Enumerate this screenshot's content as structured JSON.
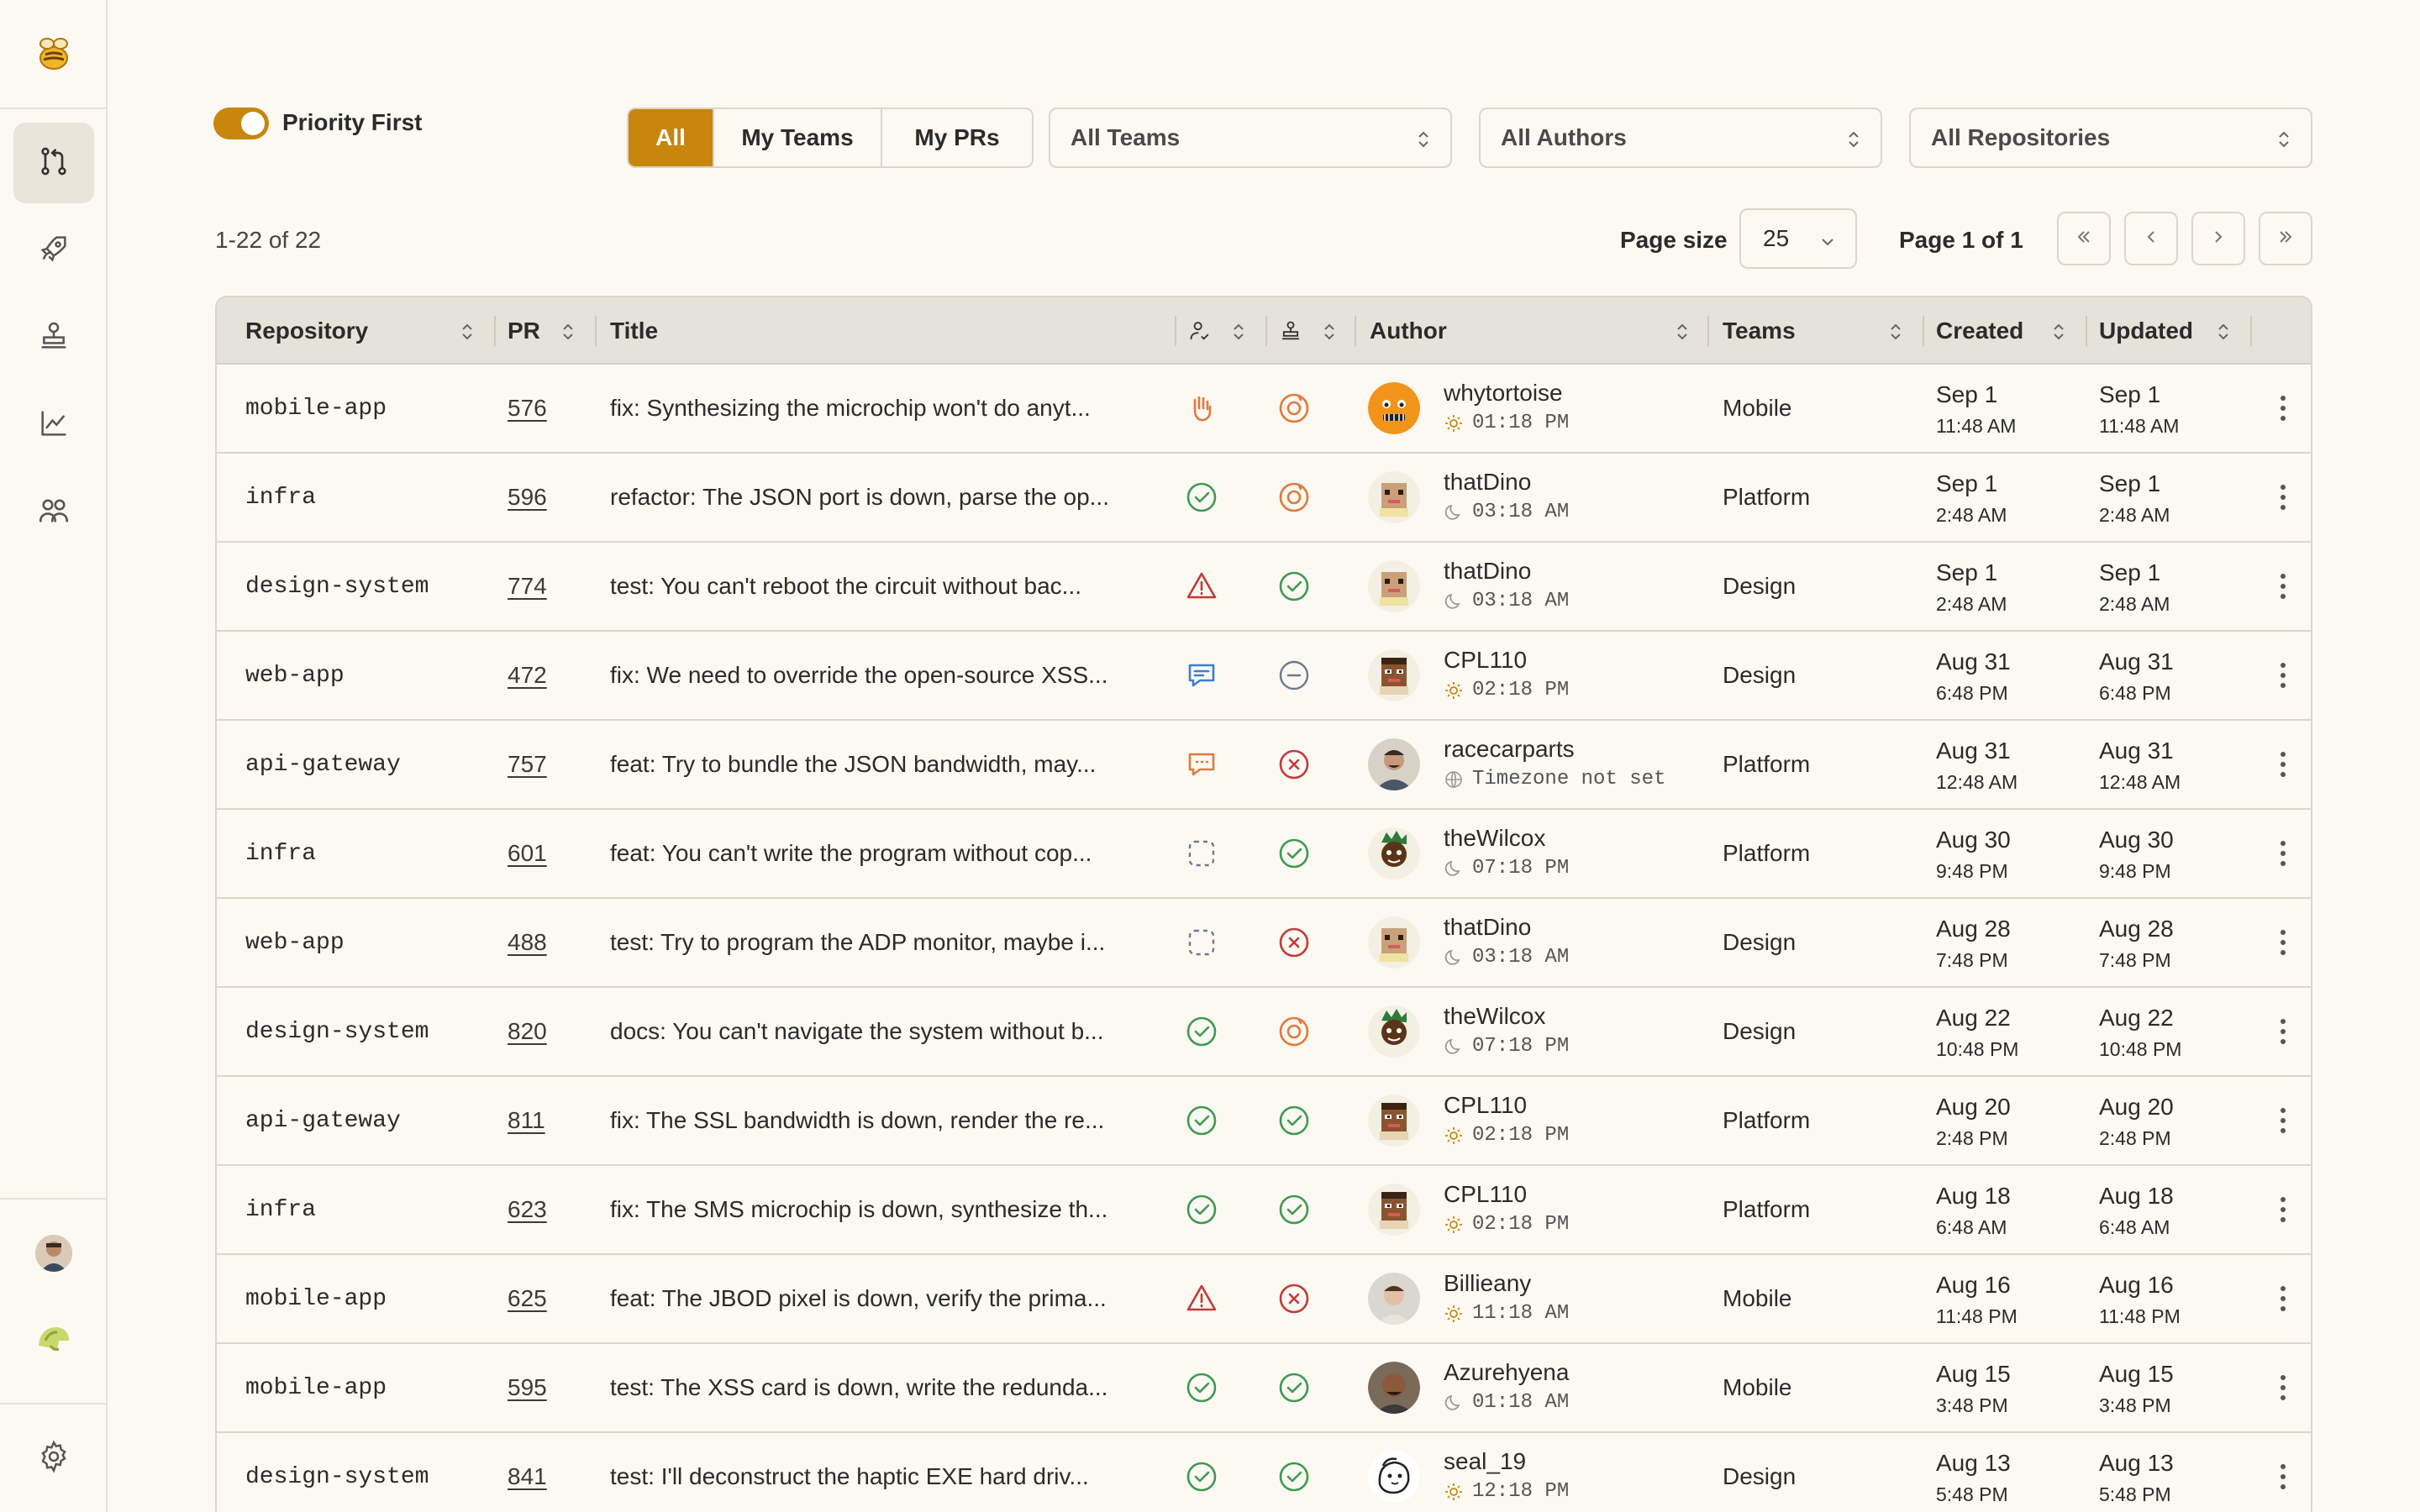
{
  "sidebar": {
    "logo": "bee-logo-icon",
    "nav": [
      {
        "icon": "pull-request-icon",
        "active": true
      },
      {
        "icon": "rocket-icon",
        "active": false
      },
      {
        "icon": "stamp-icon",
        "active": false
      },
      {
        "icon": "chart-line-icon",
        "active": false
      },
      {
        "icon": "users-icon",
        "active": false
      }
    ],
    "bottom": [
      "user-avatar",
      "helmet-logo-icon"
    ],
    "settings": "gear-icon"
  },
  "toolbar": {
    "priority_toggle_label": "Priority First",
    "priority_toggle_on": true,
    "filters": [
      "All",
      "My Teams",
      "My PRs"
    ],
    "active_filter": "All",
    "teams_select": "All Teams",
    "authors_select": "All Authors",
    "repos_select": "All Repositories"
  },
  "pagination": {
    "range_text": "1-22 of 22",
    "page_size_label": "Page size",
    "page_size": "25",
    "page_info": "Page 1 of 1"
  },
  "table": {
    "headers": {
      "repository": "Repository",
      "pr": "PR",
      "title": "Title",
      "author": "Author",
      "teams": "Teams",
      "created": "Created",
      "updated": "Updated"
    },
    "rows": [
      {
        "repo": "mobile-app",
        "pr": "576",
        "title": "fix: Synthesizing the microchip won't do anyt...",
        "status1": "hand",
        "status2": "pending",
        "author": "whytortoise",
        "tz": "01:18 PM",
        "tz_icon": "sun",
        "avatar": "orange",
        "team": "Mobile",
        "created_date": "Sep 1",
        "created_time": "11:48 AM",
        "updated_date": "Sep 1",
        "updated_time": "11:48 AM"
      },
      {
        "repo": "infra",
        "pr": "596",
        "title": "refactor: The JSON port is down, parse the op...",
        "status1": "check",
        "status2": "pending",
        "author": "thatDino",
        "tz": "03:18 AM",
        "tz_icon": "moon",
        "avatar": "dino",
        "team": "Platform",
        "created_date": "Sep 1",
        "created_time": "2:48 AM",
        "updated_date": "Sep 1",
        "updated_time": "2:48 AM"
      },
      {
        "repo": "design-system",
        "pr": "774",
        "title": "test: You can't reboot the circuit without bac...",
        "status1": "warning",
        "status2": "check",
        "author": "thatDino",
        "tz": "03:18 AM",
        "tz_icon": "moon",
        "avatar": "dino",
        "team": "Design",
        "created_date": "Sep 1",
        "created_time": "2:48 AM",
        "updated_date": "Sep 1",
        "updated_time": "2:48 AM"
      },
      {
        "repo": "web-app",
        "pr": "472",
        "title": "fix: We need to override the open-source XSS...",
        "status1": "comment-blue",
        "status2": "neutral",
        "author": "CPL110",
        "tz": "02:18 PM",
        "tz_icon": "sun",
        "avatar": "cpl",
        "team": "Design",
        "created_date": "Aug 31",
        "created_time": "6:48 PM",
        "updated_date": "Aug 31",
        "updated_time": "6:48 PM"
      },
      {
        "repo": "api-gateway",
        "pr": "757",
        "title": "feat: Try to bundle the JSON bandwidth, may...",
        "status1": "comment-orange",
        "status2": "x",
        "author": "racecarparts",
        "tz": "Timezone not set",
        "tz_icon": "globe",
        "avatar": "photo",
        "team": "Platform",
        "created_date": "Aug 31",
        "created_time": "12:48 AM",
        "updated_date": "Aug 31",
        "updated_time": "12:48 AM"
      },
      {
        "repo": "infra",
        "pr": "601",
        "title": "feat: You can't write the program without cop...",
        "status1": "draft",
        "status2": "check",
        "author": "theWilcox",
        "tz": "07:18 PM",
        "tz_icon": "moon",
        "avatar": "wilcox",
        "team": "Platform",
        "created_date": "Aug 30",
        "created_time": "9:48 PM",
        "updated_date": "Aug 30",
        "updated_time": "9:48 PM"
      },
      {
        "repo": "web-app",
        "pr": "488",
        "title": "test: Try to program the ADP monitor, maybe i...",
        "status1": "draft",
        "status2": "x",
        "author": "thatDino",
        "tz": "03:18 AM",
        "tz_icon": "moon",
        "avatar": "dino",
        "team": "Design",
        "created_date": "Aug 28",
        "created_time": "7:48 PM",
        "updated_date": "Aug 28",
        "updated_time": "7:48 PM"
      },
      {
        "repo": "design-system",
        "pr": "820",
        "title": "docs: You can't navigate the system without b...",
        "status1": "check",
        "status2": "pending",
        "author": "theWilcox",
        "tz": "07:18 PM",
        "tz_icon": "moon",
        "avatar": "wilcox",
        "team": "Design",
        "created_date": "Aug 22",
        "created_time": "10:48 PM",
        "updated_date": "Aug 22",
        "updated_time": "10:48 PM"
      },
      {
        "repo": "api-gateway",
        "pr": "811",
        "title": "fix: The SSL bandwidth is down, render the re...",
        "status1": "check",
        "status2": "check",
        "author": "CPL110",
        "tz": "02:18 PM",
        "tz_icon": "sun",
        "avatar": "cpl",
        "team": "Platform",
        "created_date": "Aug 20",
        "created_time": "2:48 PM",
        "updated_date": "Aug 20",
        "updated_time": "2:48 PM"
      },
      {
        "repo": "infra",
        "pr": "623",
        "title": "fix: The SMS microchip is down, synthesize th...",
        "status1": "check",
        "status2": "check",
        "author": "CPL110",
        "tz": "02:18 PM",
        "tz_icon": "sun",
        "avatar": "cpl",
        "team": "Platform",
        "created_date": "Aug 18",
        "created_time": "6:48 AM",
        "updated_date": "Aug 18",
        "updated_time": "6:48 AM"
      },
      {
        "repo": "mobile-app",
        "pr": "625",
        "title": "feat: The JBOD pixel is down, verify the prima...",
        "status1": "warning",
        "status2": "x",
        "author": "Billieany",
        "tz": "11:18 AM",
        "tz_icon": "sun",
        "avatar": "billie",
        "team": "Mobile",
        "created_date": "Aug 16",
        "created_time": "11:48 PM",
        "updated_date": "Aug 16",
        "updated_time": "11:48 PM"
      },
      {
        "repo": "mobile-app",
        "pr": "595",
        "title": "test: The XSS card is down, write the redunda...",
        "status1": "check",
        "status2": "check",
        "author": "Azurehyena",
        "tz": "01:18 AM",
        "tz_icon": "moon",
        "avatar": "azure",
        "team": "Mobile",
        "created_date": "Aug 15",
        "created_time": "3:48 PM",
        "updated_date": "Aug 15",
        "updated_time": "3:48 PM"
      },
      {
        "repo": "design-system",
        "pr": "841",
        "title": "test: I'll deconstruct the haptic EXE hard driv...",
        "status1": "check",
        "status2": "check",
        "author": "seal_19",
        "tz": "12:18 PM",
        "tz_icon": "sun",
        "avatar": "seal",
        "team": "Design",
        "created_date": "Aug 13",
        "created_time": "5:48 PM",
        "updated_date": "Aug 13",
        "updated_time": "5:48 PM"
      }
    ]
  },
  "colors": {
    "accent": "#c8860d",
    "success": "#3e9a52",
    "danger": "#c23a3a",
    "warning_orange": "#e07a3c",
    "info_blue": "#3a7fd0"
  }
}
